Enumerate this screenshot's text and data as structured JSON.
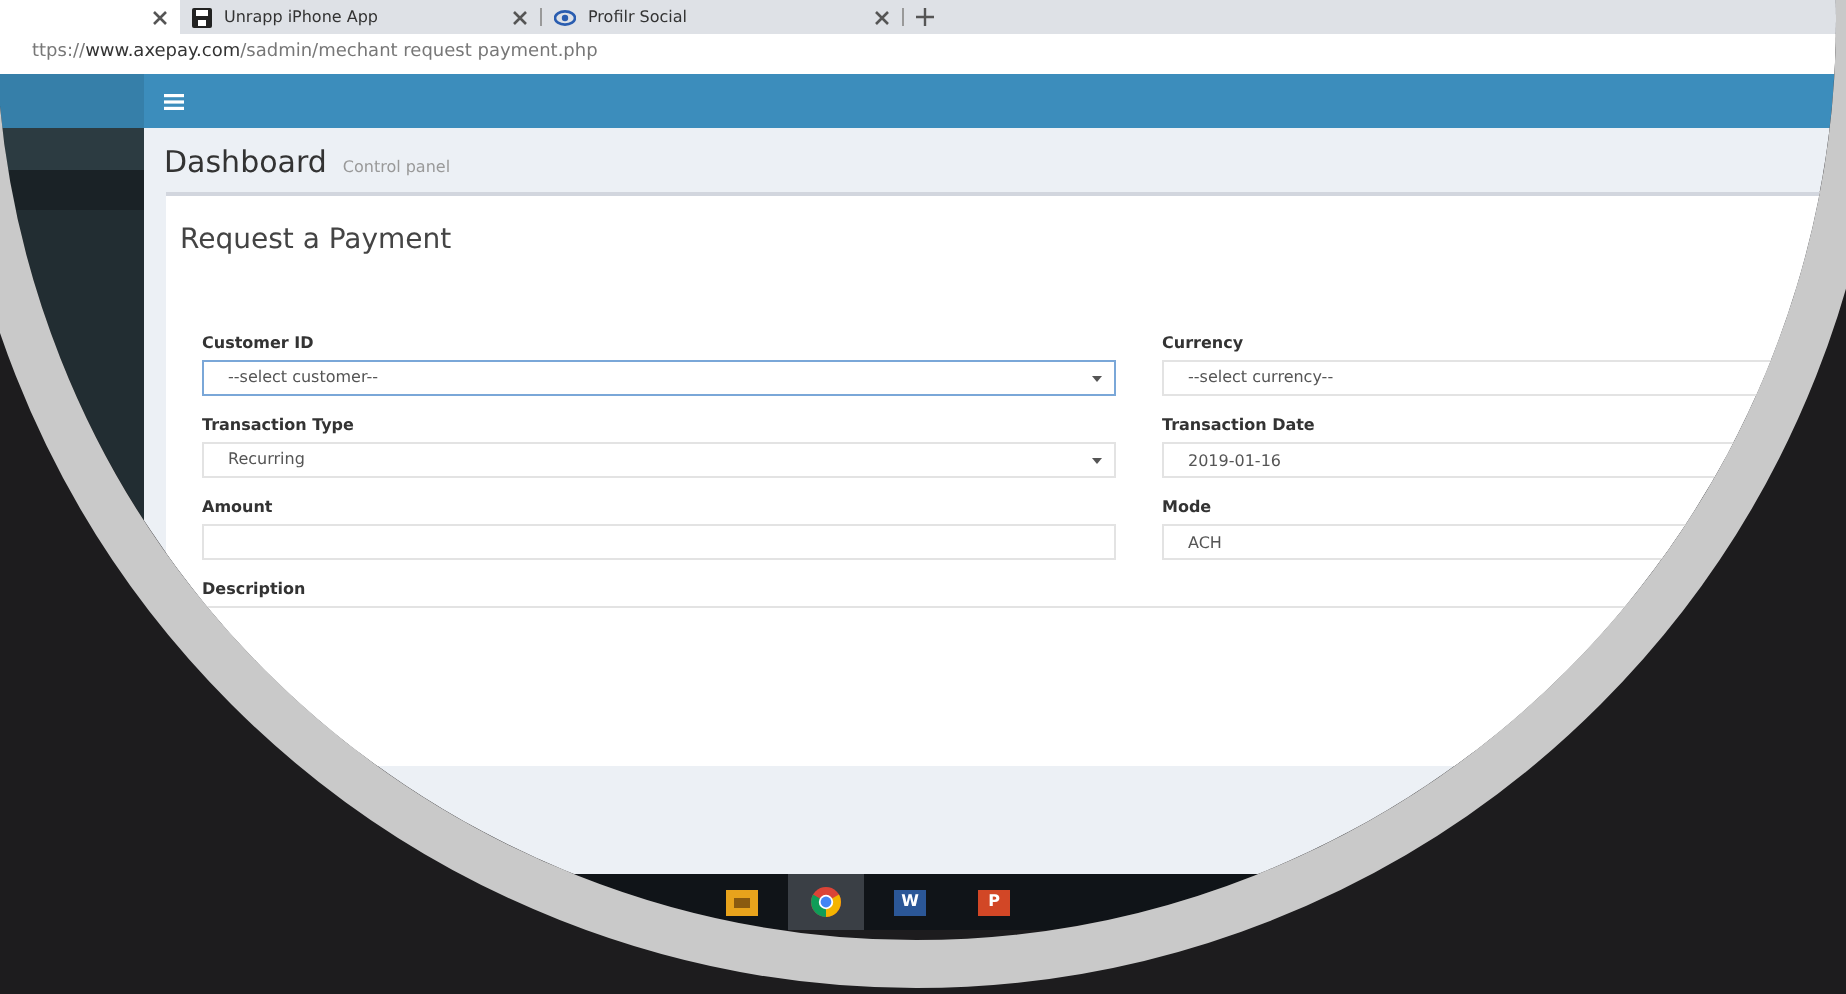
{
  "browser": {
    "tabs": [
      {
        "selected": true
      },
      {
        "title": "Unrapp iPhone App",
        "selected": false
      },
      {
        "title": "Profilr Social",
        "selected": false
      }
    ],
    "url": "ttps://**www.axepay.com**/sadmin/mechant request payment.php"
  },
  "page_header": {
    "title": "Dashboard",
    "subtitle": "Control panel"
  },
  "form": {
    "title": "Request a Payment",
    "left_fields": [
      {
        "kind": "select",
        "label": "Customer ID",
        "value": "--select customer--",
        "focused": true
      },
      {
        "kind": "select",
        "label": "Transaction Type",
        "value": "Recurring",
        "focused": false
      },
      {
        "kind": "input",
        "label": "Amount",
        "focused": false
      }
    ],
    "right_fields": [
      {
        "kind": "select",
        "label": "Currency",
        "value": "--select currency--",
        "focused": false
      },
      {
        "kind": "input",
        "label": "Transaction Date",
        "value": "2019-01-16",
        "focused": false
      },
      {
        "kind": "input",
        "label": "Mode",
        "value": "ACH",
        "focused": false
      }
    ],
    "description": {
      "label": "Description",
      "focused": false
    }
  },
  "taskbar": [
    {
      "kind": "app",
      "selected": false
    },
    {
      "kind": "browser",
      "selected": true
    },
    {
      "kind": "word",
      "letter": "W",
      "selected": false
    },
    {
      "kind": "powerpoint",
      "letter": "P",
      "selected": false
    }
  ]
}
